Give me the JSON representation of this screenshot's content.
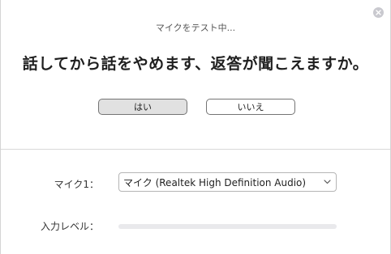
{
  "dialog": {
    "status_text": "マイクをテスト中...",
    "question": "話してから話をやめます、返答が聞こえますか。",
    "yes_label": "はい",
    "no_label": "いいえ",
    "close_icon": "close-icon"
  },
  "mic": {
    "label": "マイク1：",
    "selected_device": "マイク (Realtek High Definition Audio)",
    "dropdown_icon": "chevron-down-icon"
  },
  "input_level": {
    "label": "入力レベル：",
    "level_fraction": 0,
    "fill_color": "#2d8cff",
    "track_color": "#e9e9ec"
  }
}
